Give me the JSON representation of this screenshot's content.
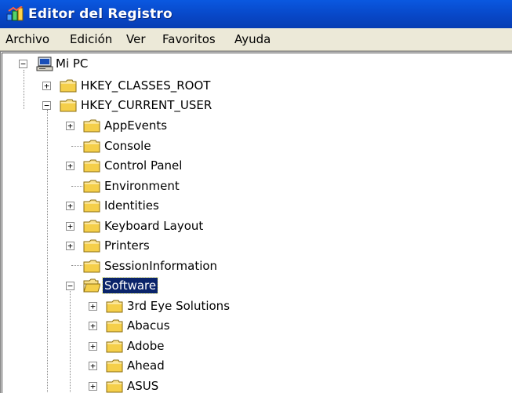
{
  "window": {
    "title": "Editor del Registro",
    "icon": "regedit-icon"
  },
  "menu": [
    "Archivo",
    "Edición",
    "Ver",
    "Favoritos",
    "Ayuda"
  ],
  "tree": {
    "root": {
      "label": "Mi PC",
      "icon": "my-computer-icon",
      "expanded": true
    },
    "hives": [
      {
        "label": "HKEY_CLASSES_ROOT",
        "expanded": false
      },
      {
        "label": "HKEY_CURRENT_USER",
        "expanded": true
      }
    ],
    "hkcu_children": [
      {
        "label": "AppEvents",
        "expandable": true
      },
      {
        "label": "Console",
        "expandable": false
      },
      {
        "label": "Control Panel",
        "expandable": true
      },
      {
        "label": "Environment",
        "expandable": false
      },
      {
        "label": "Identities",
        "expandable": true
      },
      {
        "label": "Keyboard Layout",
        "expandable": true
      },
      {
        "label": "Printers",
        "expandable": true
      },
      {
        "label": "SessionInformation",
        "expandable": false
      },
      {
        "label": "Software",
        "expandable": true,
        "expanded": true,
        "selected": true
      }
    ],
    "software_children": [
      {
        "label": "3rd Eye Solutions",
        "expandable": true
      },
      {
        "label": "Abacus",
        "expandable": true
      },
      {
        "label": "Adobe",
        "expandable": true
      },
      {
        "label": "Ahead",
        "expandable": true
      },
      {
        "label": "ASUS",
        "expandable": true
      }
    ]
  },
  "colors": {
    "titlebar": "#0847c7",
    "menubar": "#ece9d8",
    "selection": "#0a246a",
    "folder": "#f5d35a"
  }
}
